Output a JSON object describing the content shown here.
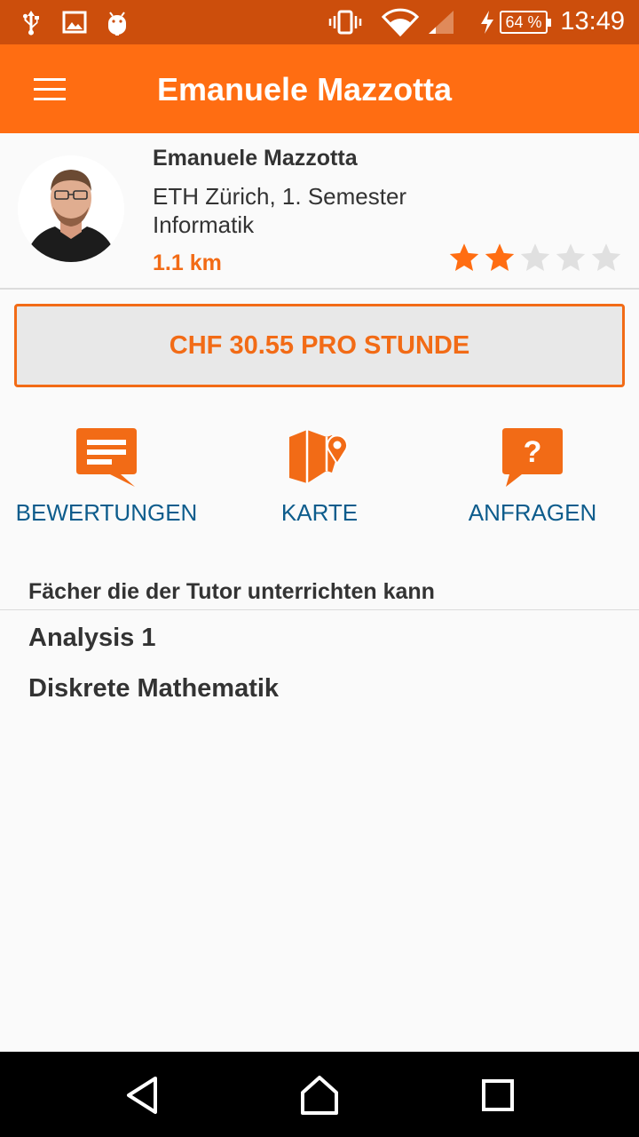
{
  "status_bar": {
    "time": "13:49",
    "battery": "64 %",
    "left_icons": [
      "usb-icon",
      "image-icon",
      "android-debug-icon"
    ],
    "right_icons": [
      "vibrate-icon",
      "wifi-icon",
      "signal-icon",
      "charging-icon",
      "battery-icon"
    ]
  },
  "app_bar": {
    "title": "Emanuele Mazzotta",
    "menu_icon": "hamburger-menu-icon"
  },
  "profile": {
    "name": "Emanuele Mazzotta",
    "university": "ETH Zürich, 1. Semester",
    "field": "Informatik",
    "distance": "1.1 km",
    "rating": 2,
    "rating_max": 5
  },
  "price_button": {
    "label": "CHF 30.55 PRO STUNDE"
  },
  "actions": [
    {
      "label": "BEWERTUNGEN",
      "icon": "reviews-icon"
    },
    {
      "label": "KARTE",
      "icon": "map-icon"
    },
    {
      "label": "ANFRAGEN",
      "icon": "question-icon"
    }
  ],
  "subjects": {
    "heading": "Fächer die der Tutor unterrichten kann",
    "items": [
      "Analysis 1",
      "Diskrete Mathematik"
    ]
  },
  "nav_bar": {
    "icons": [
      "back-icon",
      "home-icon",
      "recents-icon"
    ]
  },
  "colors": {
    "accent": "#ff6d12",
    "status_bar": "#cc4e0c",
    "link": "#0d5c8c",
    "star_empty": "#e0e0e0"
  }
}
